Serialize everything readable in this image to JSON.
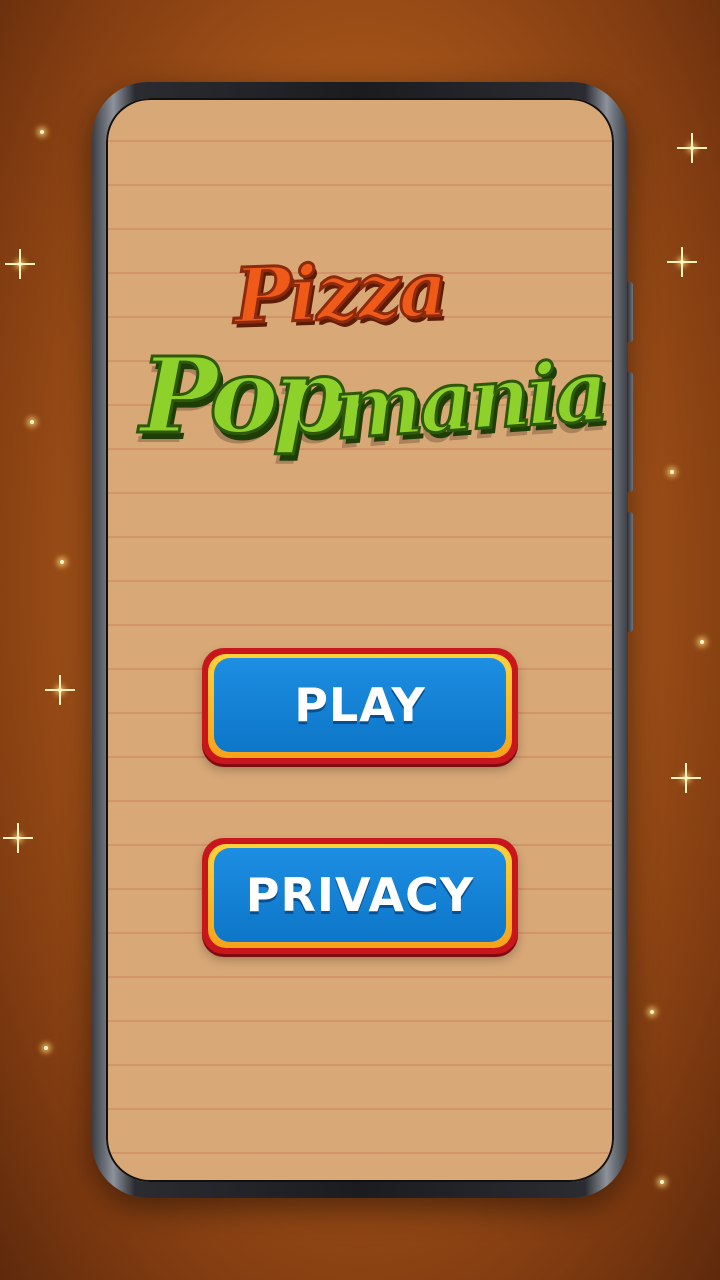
{
  "logo": {
    "line1": "Pizza",
    "line2a": "Pop",
    "line2b": "mania"
  },
  "menu": {
    "play_label": "PLAY",
    "privacy_label": "PRIVACY"
  },
  "colors": {
    "background": "#a8561a",
    "screen": "#d8a877",
    "button_face": "#1d8ee2",
    "button_border": "#c8161c",
    "button_ring": "#ffd23a",
    "logo_pizza": "#ef5a18",
    "logo_popmania": "#8ed12a"
  }
}
